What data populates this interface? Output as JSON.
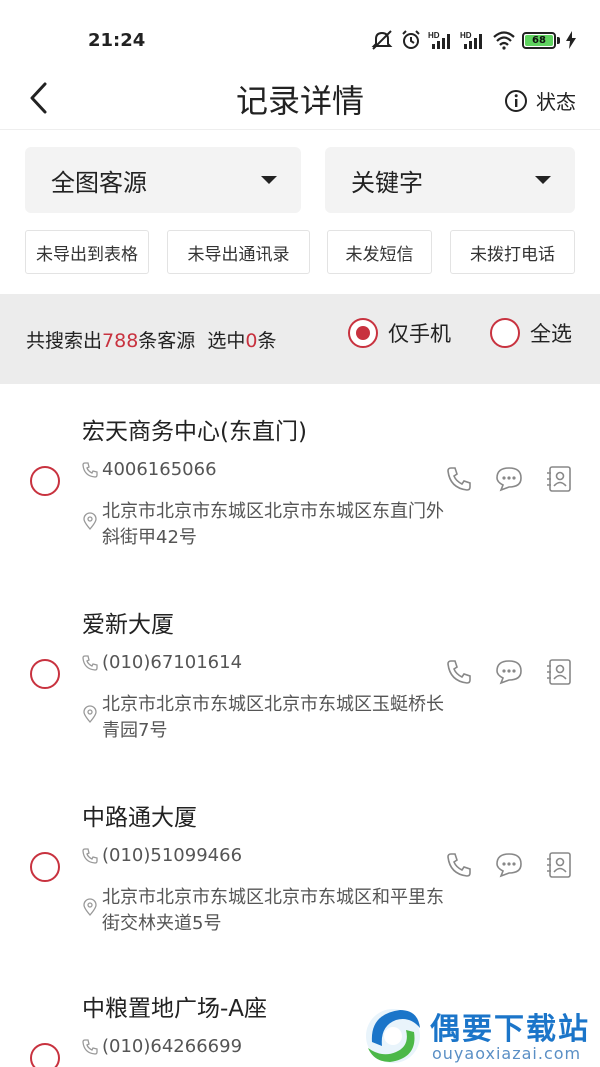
{
  "status_bar": {
    "time": "21:24",
    "battery": "68"
  },
  "header": {
    "title": "记录详情",
    "status_label": "状态"
  },
  "dropdowns": [
    {
      "label": "全图客源"
    },
    {
      "label": "关键字"
    }
  ],
  "filters": [
    "未导出到表格",
    "未导出通讯录",
    "未发短信",
    "未拨打电话"
  ],
  "summary": {
    "prefix": "共搜索出",
    "count": "788",
    "middle": "条客源  选中",
    "selected": "0",
    "suffix": "条",
    "option_phone_only": "仅手机",
    "option_select_all": "全选"
  },
  "records": [
    {
      "name": "宏天商务中心(东直门)",
      "phone": "4006165066",
      "address": "北京市北京市东城区北京市东城区东直门外斜街甲42号"
    },
    {
      "name": "爱新大厦",
      "phone": "(010)67101614",
      "address": "北京市北京市东城区北京市东城区玉蜓桥长青园7号"
    },
    {
      "name": "中路通大厦",
      "phone": "(010)51099466",
      "address": "北京市北京市东城区北京市东城区和平里东街交林夹道5号"
    },
    {
      "name": "中粮置地广场-A座",
      "phone": "(010)64266699",
      "address": ""
    }
  ],
  "watermark": {
    "brand": "偶要下载站",
    "url": "ouyaoxiazai.com"
  },
  "colors": {
    "accent": "#c8323f",
    "summary_bg": "#ececec",
    "dropdown_bg": "#f3f3f3"
  }
}
